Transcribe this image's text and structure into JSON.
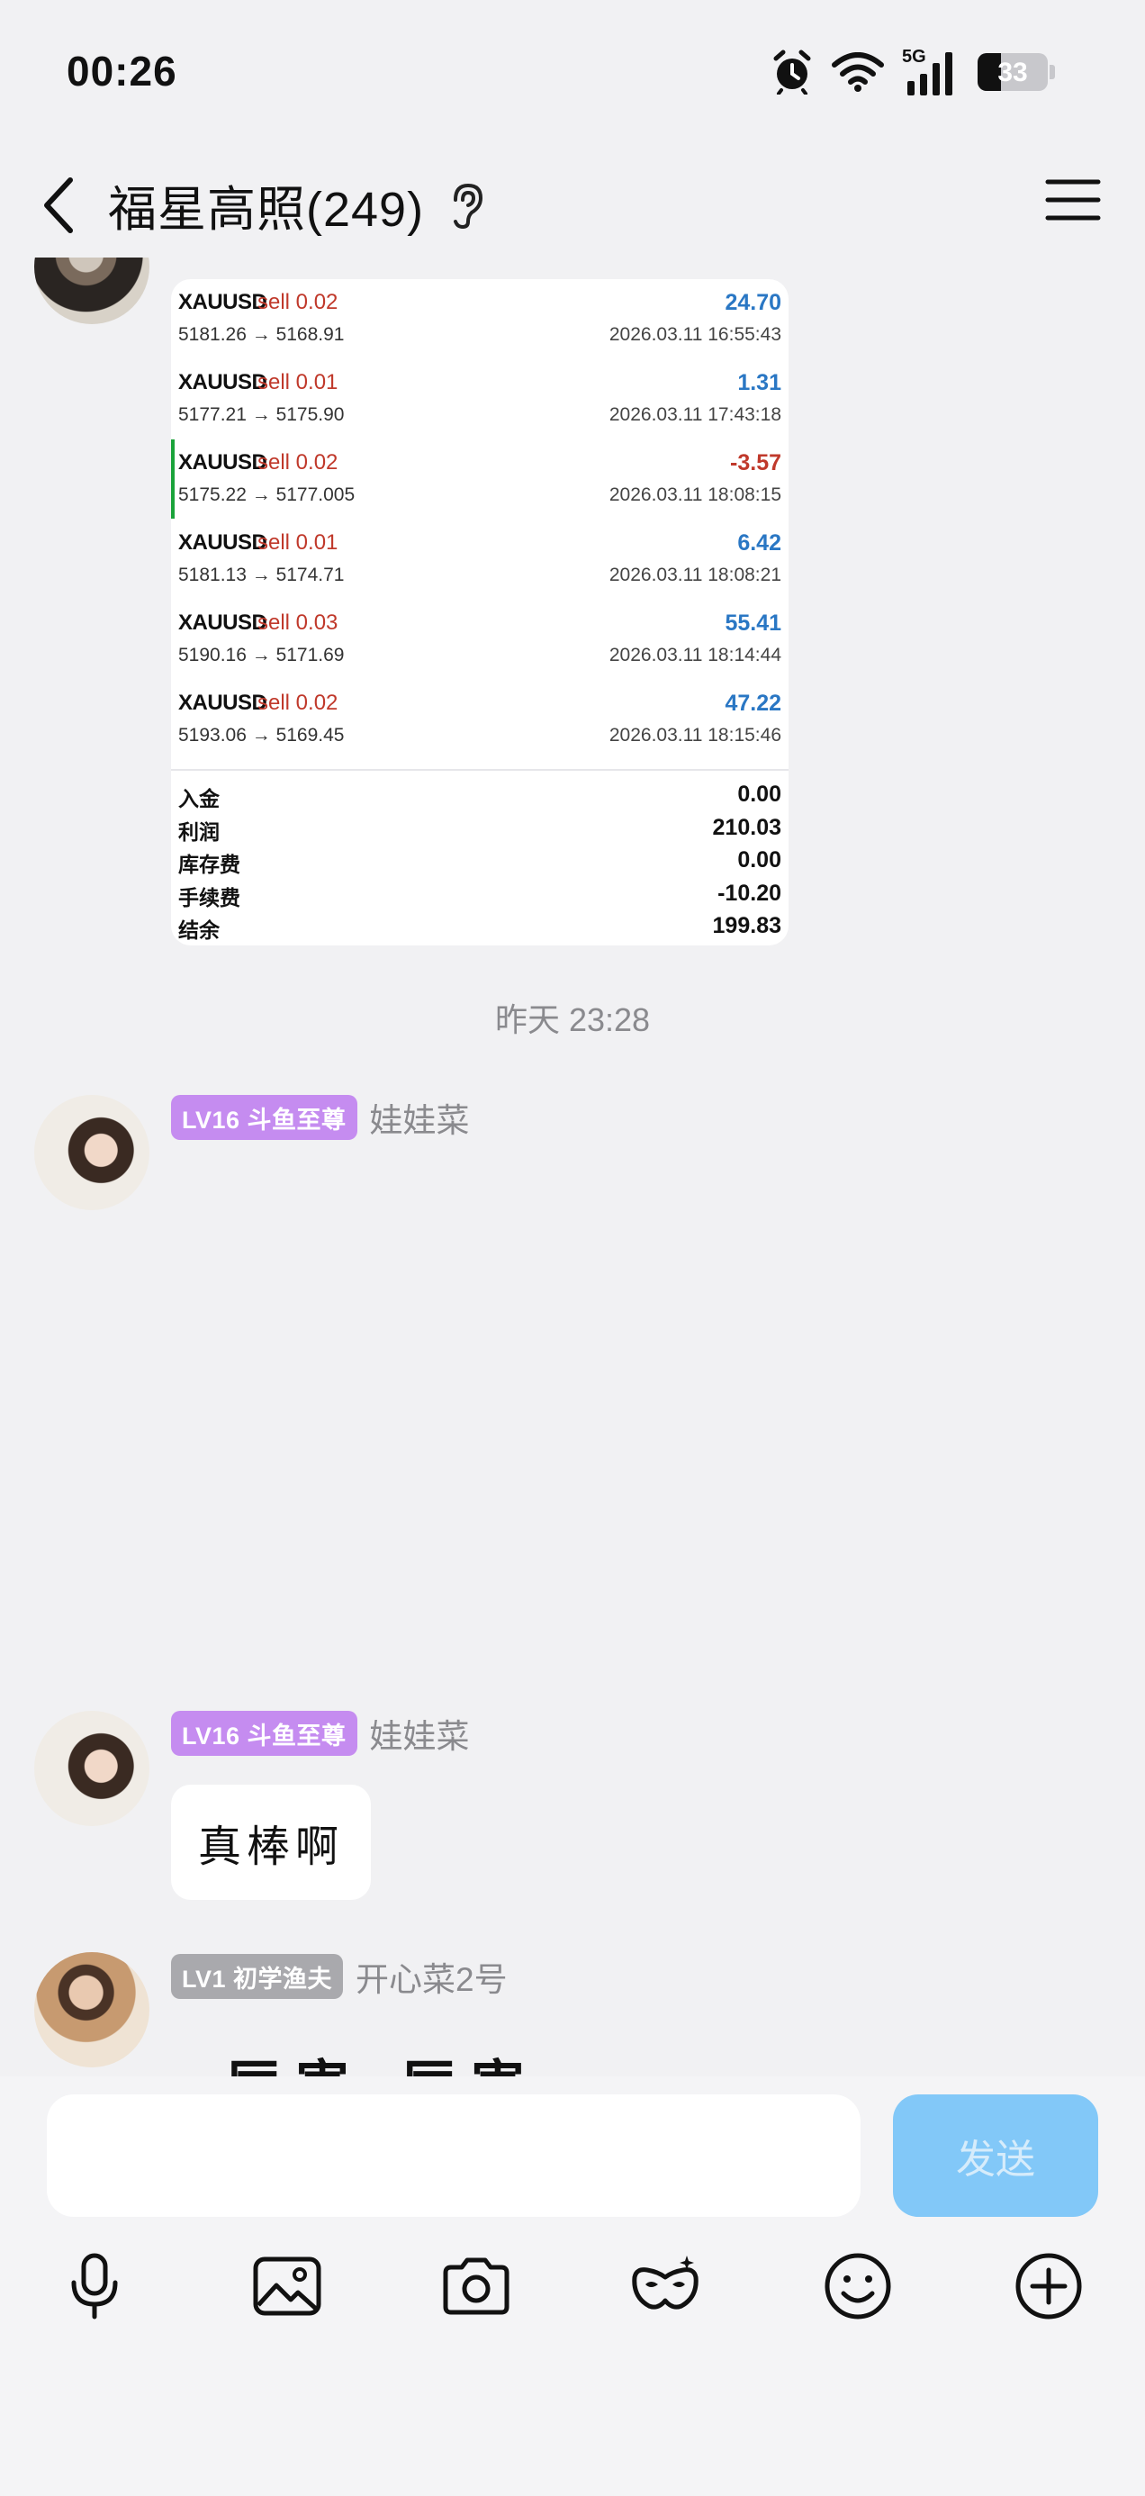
{
  "status_bar": {
    "time": "00:26",
    "network": "5G",
    "battery": "33"
  },
  "header": {
    "title": "福星高照(249)"
  },
  "trade_card": {
    "trades": [
      {
        "symbol": "XAUUSD",
        "side": "sell 0.02",
        "prices": "5181.26 → 5168.91",
        "profit": "24.70",
        "date": "2026.03.11 16:55:43"
      },
      {
        "symbol": "XAUUSD",
        "side": "sell 0.01",
        "prices": "5177.21 → 5175.90",
        "profit": "1.31",
        "date": "2026.03.11 17:43:18"
      },
      {
        "symbol": "XAUUSD",
        "side": "sell 0.02",
        "prices": "5175.22 → 5177.005",
        "profit": "-3.57",
        "date": "2026.03.11 18:08:15"
      },
      {
        "symbol": "XAUUSD",
        "side": "sell 0.01",
        "prices": "5181.13 → 5174.71",
        "profit": "6.42",
        "date": "2026.03.11 18:08:21"
      },
      {
        "symbol": "XAUUSD",
        "side": "sell 0.03",
        "prices": "5190.16 → 5171.69",
        "profit": "55.41",
        "date": "2026.03.11 18:14:44"
      },
      {
        "symbol": "XAUUSD",
        "side": "sell 0.02",
        "prices": "5193.06 → 5169.45",
        "profit": "47.22",
        "date": "2026.03.11 18:15:46"
      }
    ],
    "summary": [
      {
        "label": "入金",
        "value": "0.00"
      },
      {
        "label": "利润",
        "value": "210.03"
      },
      {
        "label": "库存费",
        "value": "0.00"
      },
      {
        "label": "手续费",
        "value": "-10.20"
      },
      {
        "label": "结余",
        "value": "199.83"
      }
    ]
  },
  "timestamp": "昨天 23:28",
  "messages": [
    {
      "badge": "LV16 斗鱼至尊",
      "sender": "娃娃菜",
      "text": ""
    },
    {
      "badge": "LV16 斗鱼至尊",
      "sender": "娃娃菜",
      "text": "真棒啊"
    },
    {
      "badge": "LV1 初学渔夫",
      "sender": "开心菜2号",
      "text": "厉害 厉害"
    }
  ],
  "input": {
    "placeholder": "",
    "send_label": "发送"
  },
  "colors": {
    "badge_purple": "#c58cf0",
    "badge_gray": "#a9a9ad",
    "send_button": "#82c8f8",
    "profit_positive": "#2a77c4",
    "profit_negative": "#c0392b"
  }
}
